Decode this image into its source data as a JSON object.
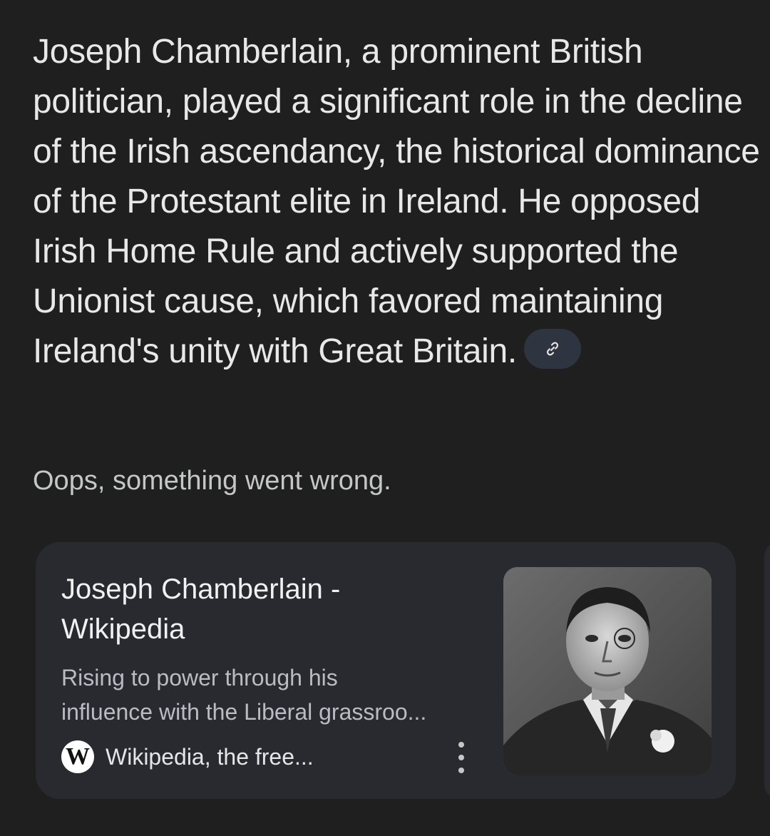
{
  "answer": {
    "text": "Joseph Chamberlain, a prominent British politician, played a significant role in the decline of the Irish ascendancy, the historical dominance of the Protestant elite in Ireland. He opposed Irish Home Rule and actively supported the Unionist cause, which favored maintaining Ireland's unity with Great Britain.",
    "link_icon": "link-icon"
  },
  "error": {
    "message": "Oops, something went wrong."
  },
  "source_card": {
    "title": "Joseph Chamberlain - Wikipedia",
    "snippet_line1": "Rising to power through his",
    "snippet_line2": "influence with the Liberal grassroo...",
    "source_name": "Wikipedia, the free...",
    "source_icon_letter": "W",
    "more_icon": "more-vert-icon",
    "thumbnail": "portrait-photo"
  }
}
